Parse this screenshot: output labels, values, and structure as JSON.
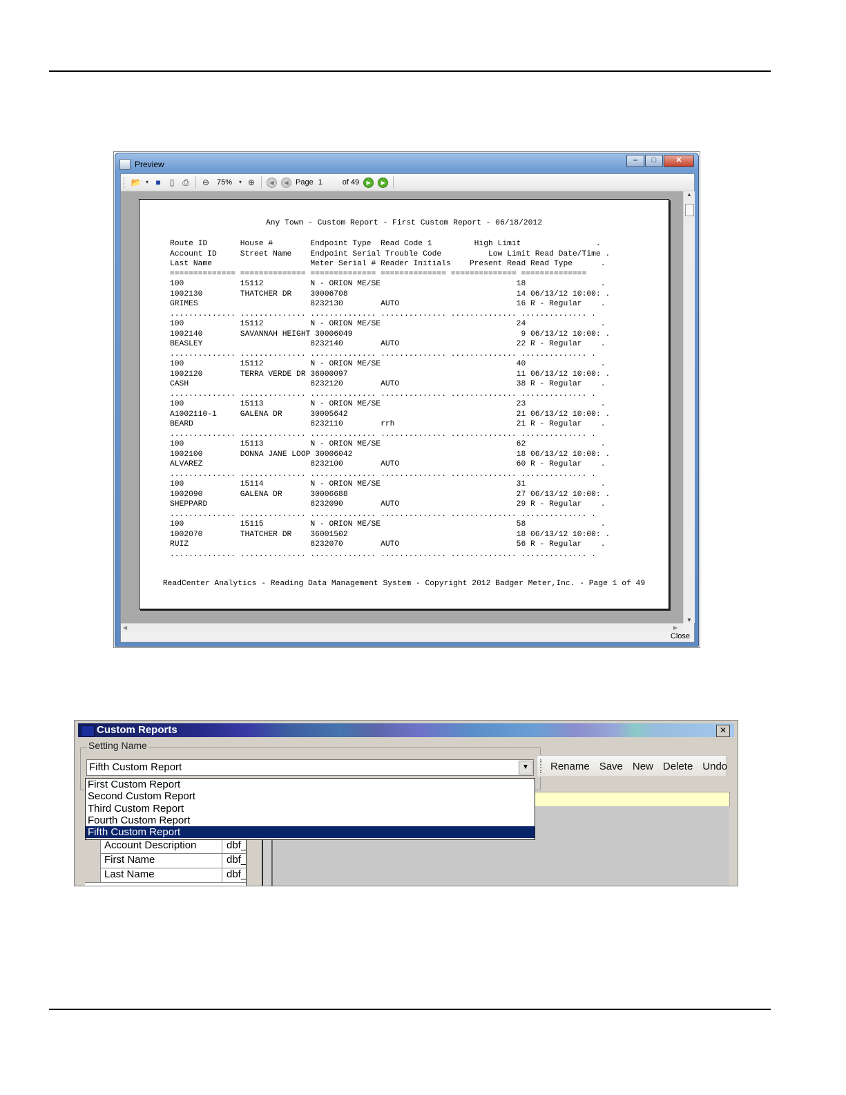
{
  "preview_window": {
    "title": "Preview",
    "toolbar": {
      "zoom": "75%",
      "page_label": "Page",
      "page_value": "1",
      "page_of": "of 49"
    },
    "close_label": "Close",
    "report": {
      "title": "Any Town - Custom Report - First Custom Report - 06/18/2012",
      "lines": [
        "Route ID       House #        Endpoint Type  Read Code 1         High Limit                .",
        "Account ID     Street Name    Endpoint Serial Trouble Code          Low Limit Read Date/Time .",
        "Last Name                     Meter Serial # Reader Initials    Present Read Read Type      .",
        "============== ============== ============== ============== ============== ==============",
        "100            15112          N - ORION ME/SE                             18                .",
        "1002130        THATCHER DR    30006708                                    14 06/13/12 10:00: .",
        "GRIMES                        8232130        AUTO                         16 R - Regular    .",
        ".............. .............. .............. .............. .............. .............. .",
        "100            15112          N - ORION ME/SE                             24                .",
        "1002140        SAVANNAH HEIGHT 30006049                                    9 06/13/12 10:00: .",
        "BEASLEY                       8232140        AUTO                         22 R - Regular    .",
        ".............. .............. .............. .............. .............. .............. .",
        "100            15112          N - ORION ME/SE                             40                .",
        "1002120        TERRA VERDE DR 36000097                                    11 06/13/12 10:00: .",
        "CASH                          8232120        AUTO                         38 R - Regular    .",
        ".............. .............. .............. .............. .............. .............. .",
        "100            15113          N - ORION ME/SE                             23                .",
        "A1002110-1     GALENA DR      30005642                                    21 06/13/12 10:00: .",
        "BEARD                         8232110        rrh                          21 R - Regular    .",
        ".............. .............. .............. .............. .............. .............. .",
        "100            15113          N - ORION ME/SE                             62                .",
        "1002100        DONNA JANE LOOP 30006042                                   18 06/13/12 10:00: .",
        "ALVAREZ                       8232100        AUTO                         60 R - Regular    .",
        ".............. .............. .............. .............. .............. .............. .",
        "100            15114          N - ORION ME/SE                             31                .",
        "1002090        GALENA DR      30006688                                    27 06/13/12 10:00: .",
        "SHEPPARD                      8232090        AUTO                         29 R - Regular    .",
        ".............. .............. .............. .............. .............. .............. .",
        "100            15115          N - ORION ME/SE                             58                .",
        "1002070        THATCHER DR    36001502                                    18 06/13/12 10:00: .",
        "RUIZ                          8232070        AUTO                         56 R - Regular    .",
        ".............. .............. .............. .............. .............. .............. ."
      ],
      "footer": "ReadCenter Analytics - Reading Data Management System - Copyright 2012 Badger Meter,Inc. - Page 1 of 49"
    }
  },
  "custom_reports_dialog": {
    "title": "Custom Reports",
    "close_glyph": "✕",
    "setting_name_label": "Setting Name",
    "selected_setting": "Fifth Custom Report",
    "dropdown_options": [
      "First Custom Report",
      "Second Custom Report",
      "Third Custom Report",
      "Fourth Custom Report",
      "Fifth Custom Report"
    ],
    "toolbar": {
      "rename": "Rename",
      "save": "Save",
      "new": "New",
      "delete": "Delete",
      "undo": "Undo"
    },
    "grid_rows": [
      {
        "name": "Account Description",
        "field": "dbf_"
      },
      {
        "name": "First Name",
        "field": "dbf_"
      },
      {
        "name": "Last Name",
        "field": "dbf_"
      }
    ]
  }
}
